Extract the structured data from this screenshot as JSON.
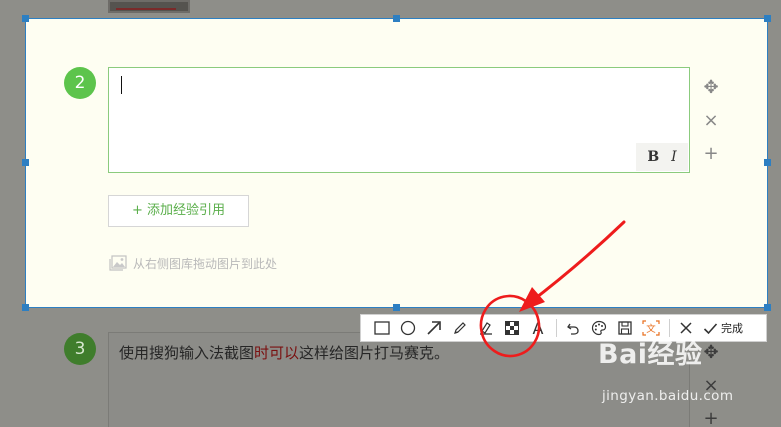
{
  "active_step": {
    "number": "2",
    "format_bold": "B",
    "format_italic": "I",
    "add_reference_label": "+ 添加经验引用",
    "drag_hint": "从右侧图库拖动图片到此处"
  },
  "next_step": {
    "number": "3",
    "text_before": "使用搜狗输入法截图",
    "text_highlight": "时可以",
    "text_after": "这样给图片打马赛克。"
  },
  "toolbar": {
    "tools": [
      "rectangle-icon",
      "ellipse-icon",
      "arrow-icon",
      "pen-icon",
      "highlighter-icon",
      "mosaic-icon",
      "text-icon",
      "undo-icon",
      "palette-icon",
      "save-icon",
      "ocr-icon",
      "close-icon"
    ],
    "text_tool_glyph": "A",
    "ocr_label": "文",
    "done_label": "完成"
  },
  "watermark": {
    "logo": "Bai经验",
    "url": "jingyan.baidu.com"
  },
  "colors": {
    "accent_green": "#5dc44c",
    "selection_blue": "#2d7fc2",
    "annotation_red": "#ee1c1c",
    "highlight_text": "#7a1010"
  }
}
